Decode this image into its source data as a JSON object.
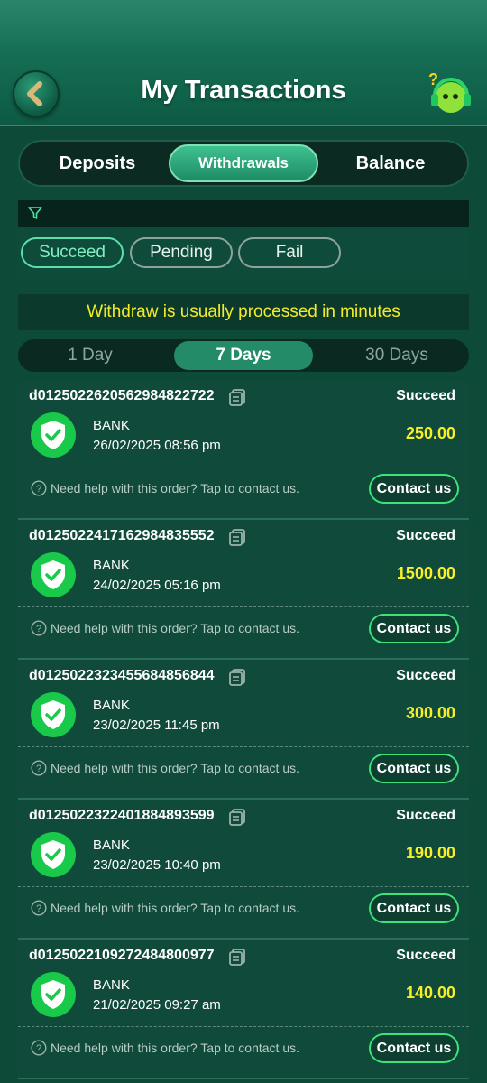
{
  "header": {
    "title": "My Transactions",
    "back_icon": "chevron-left-icon",
    "help_icon": "help-mascot-icon"
  },
  "main_tabs": [
    {
      "label": "Deposits",
      "active": false
    },
    {
      "label": "Withdrawals",
      "active": true
    },
    {
      "label": "Balance",
      "active": false
    }
  ],
  "filter": {
    "icon": "filter-icon"
  },
  "status_tabs": [
    {
      "label": "Succeed",
      "active": true
    },
    {
      "label": "Pending",
      "active": false
    },
    {
      "label": "Fail",
      "active": false
    }
  ],
  "notice": "Withdraw is usually processed in minutes",
  "day_tabs": [
    {
      "label": "1 Day",
      "active": false
    },
    {
      "label": "7 Days",
      "active": true
    },
    {
      "label": "30 Days",
      "active": false
    }
  ],
  "help_text": "Need help with this order? Tap to contact us.",
  "contact_label": "Contact us",
  "transactions": [
    {
      "id": "d0125022620562984822722",
      "status": "Succeed",
      "method": "BANK",
      "time": "26/02/2025 08:56 pm",
      "amount": "250.00"
    },
    {
      "id": "d0125022417162984835552",
      "status": "Succeed",
      "method": "BANK",
      "time": "24/02/2025 05:16 pm",
      "amount": "1500.00"
    },
    {
      "id": "d0125022323455684856844",
      "status": "Succeed",
      "method": "BANK",
      "time": "23/02/2025 11:45 pm",
      "amount": "300.00"
    },
    {
      "id": "d0125022322401884893599",
      "status": "Succeed",
      "method": "BANK",
      "time": "23/02/2025 10:40 pm",
      "amount": "190.00"
    },
    {
      "id": "d0125022109272484800977",
      "status": "Succeed",
      "method": "BANK",
      "time": "21/02/2025 09:27 am",
      "amount": "140.00"
    }
  ],
  "colors": {
    "accent_green": "#3ce27a",
    "amount_yellow": "#f6ef2a",
    "notice_yellow": "#f3ec2b"
  }
}
